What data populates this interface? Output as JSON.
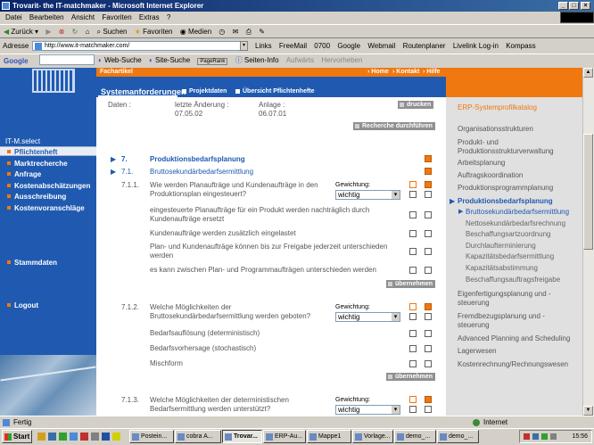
{
  "window": {
    "title": "Trovarit- the IT-matchmaker - Microsoft Internet Explorer"
  },
  "menu": [
    "Datei",
    "Bearbeiten",
    "Ansicht",
    "Favoriten",
    "Extras",
    "?"
  ],
  "toolbar": {
    "back": "Zurück",
    "search": "Suchen",
    "favorites": "Favoriten",
    "media": "Medien"
  },
  "address": {
    "label": "Adresse",
    "url": "http://www.it-matchmaker.com/",
    "links_label": "Links",
    "links": [
      "FreeMail",
      "0700",
      "Google",
      "Webmail",
      "Routenplaner",
      "Livelink Log-in",
      "Kompass"
    ]
  },
  "googlebar": {
    "label": "Google",
    "web_search": "Web-Suche",
    "site_search": "Site-Suche",
    "pagerank": "PageRank",
    "page_info": "Seiten-Info",
    "up": "Aufwärts",
    "highlight": "Hervorheben"
  },
  "site": {
    "fachartikel": "Fachartikel",
    "top_links": [
      "Home",
      "Kontakt",
      "Hilfe"
    ],
    "tabs": {
      "active": "Systemanforderungen",
      "projektdaten": "Projektdaten",
      "uebersicht": "Übersicht Pflichtenhefte"
    },
    "nav_title": "IT-M.select",
    "nav": [
      "Pflichtenheft",
      "Marktrecherche",
      "Anfrage",
      "Kostenabschätzungen",
      "Ausschreibung",
      "Kostenvoranschläge"
    ],
    "stammdaten": "Stammdaten",
    "logout": "Logout"
  },
  "meta": {
    "daten_label": "Daten :",
    "letzte_label": "letzte Änderung :",
    "letzte_value": "07.05.02",
    "anlage_label": "Anlage :",
    "anlage_value": "06.07.01",
    "drucken": "drucken",
    "recherche": "Recherche durchführen"
  },
  "section": {
    "num": "7.",
    "title": "Produktionsbedarfsplanung",
    "sub_num": "7.1.",
    "sub_title": "Bruttosekundärbedarfsermittlung"
  },
  "questions": [
    {
      "num": "7.1.1.",
      "text": "Wie werden Planaufträge und Kundenaufträge in den Produktionsplan eingesteuert?",
      "gewichtung_label": "Gewichtung:",
      "gewichtung": "wichtig",
      "options": [
        "eingesteuerte Planaufträge für ein Produkt werden nachträglich durch Kundenaufträge ersetzt",
        "Kundenaufträge werden zusätzlich eingelastet",
        "Plan- und Kundenaufträge können bis zur Freigabe jederzeit unterschieden werden",
        "es kann zwischen Plan- und Programmaufträgen unterschieden werden"
      ]
    },
    {
      "num": "7.1.2.",
      "text": "Welche Möglichkeiten der Bruttosekundärbedarfsermittlung werden geboten?",
      "gewichtung_label": "Gewichtung:",
      "gewichtung": "wichtig",
      "options": [
        "Bedarfsauflösung (deterministisch)",
        "Bedarfsvorhersage (stochastisch)",
        "Mischform"
      ]
    },
    {
      "num": "7.1.3.",
      "text": "Welche Möglichkeiten der deterministischen Bedarfsermittlung werden unterstützt?",
      "gewichtung_label": "Gewichtung:",
      "gewichtung": "wichtig"
    }
  ],
  "uebernehmen": "übernehmen",
  "right_panel": {
    "title": "ERP-Systemprofilkatalog",
    "items": [
      "Organisationsstrukturen",
      "Produkt- und Produktionsstrukturverwaltung",
      "Arbeitsplanung",
      "Auftragskoordination",
      "Produktionsprogrammplanung"
    ],
    "current": "Produktionsbedarfsplanung",
    "sub_current": "Bruttosekundärbedarfsermittlung",
    "subs": [
      "Nettosekundärbedarfsrechnung",
      "Beschaffungsartzuordnung",
      "Durchlaufterminierung",
      "Kapazitätsbedarfsermittlung",
      "Kapazitätsabstimmung",
      "Beschaffungsauftragsfreigabe"
    ],
    "after": [
      "Eigenfertigungsplanung und -steuerung",
      "Fremdbezugsplanung und -steuerung",
      "Advanced Planning and Scheduling",
      "Lagerwesen",
      "Kostenrechnung/Rechnungswesen"
    ]
  },
  "status": {
    "left": "Fertig",
    "zone": "Internet"
  },
  "taskbar": {
    "start": "Start",
    "tasks": [
      "Postein...",
      "cobra A...",
      "Trovar...",
      "ERP-Au...",
      "Mappe1",
      "Vorlage...",
      "demo_...",
      "demo_..."
    ],
    "clock": "15:56"
  },
  "colors": {
    "brand_blue": "#1f5ab0",
    "brand_orange": "#f07810"
  }
}
